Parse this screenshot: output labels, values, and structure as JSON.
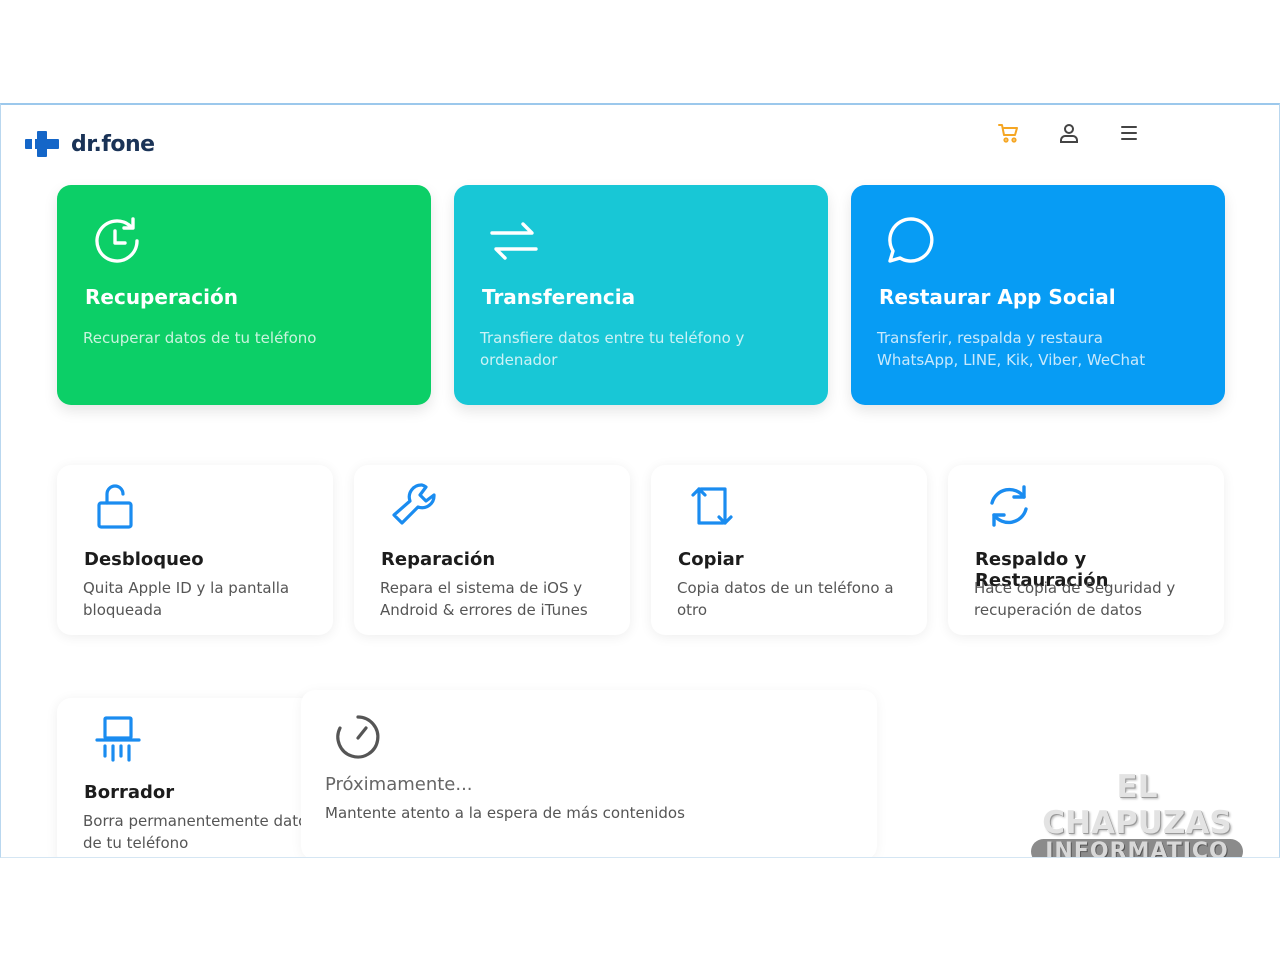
{
  "app": {
    "logo_text": "dr.fone"
  },
  "header": {
    "icons": [
      {
        "name": "cart-icon",
        "color": "#f5a623"
      },
      {
        "name": "user-icon",
        "color": "#444444"
      },
      {
        "name": "menu-icon",
        "color": "#444444"
      }
    ]
  },
  "featured": [
    {
      "id": "recuperacion",
      "icon": "clock-refresh-icon",
      "title": "Recuperación",
      "description": "Recuperar datos de tu teléfono",
      "color": "#0ccf67"
    },
    {
      "id": "transferencia",
      "icon": "transfer-arrows-icon",
      "title": "Transferencia",
      "description": "Transfiere datos entre tu teléfono y ordenador",
      "color": "#18c7d6"
    },
    {
      "id": "restaurar-app-social",
      "icon": "chat-bubble-icon",
      "title": "Restaurar App Social",
      "description": "Transferir, respalda y restaura WhatsApp, LINE, Kik, Viber, WeChat",
      "color": "#079cf4"
    }
  ],
  "tools": [
    {
      "id": "desbloqueo",
      "icon": "unlock-icon",
      "title": "Desbloqueo",
      "description": "Quita Apple ID y la pantalla bloqueada"
    },
    {
      "id": "reparacion",
      "icon": "wrench-icon",
      "title": "Reparación",
      "description": "Repara el sistema de iOS y Android & errores de iTunes"
    },
    {
      "id": "copiar",
      "icon": "phone-rotate-icon",
      "title": "Copiar",
      "description": "Copia datos de un teléfono a otro"
    },
    {
      "id": "respaldo",
      "icon": "sync-icon",
      "title": "Respaldo y Restauración",
      "description": "Hace copia de Seguridad y recuperación de datos"
    },
    {
      "id": "borrador",
      "icon": "shredder-icon",
      "title": "Borrador",
      "description": "Borra permanentemente datos de tu teléfono"
    }
  ],
  "coming_soon": {
    "icon": "timer-icon",
    "title": "Próximamente...",
    "description": "Mantente atento a la espera de más contenidos"
  },
  "watermark": {
    "line1": "EL CHAPUZAS",
    "line2": "INFORMATICO"
  },
  "colors": {
    "accent": "#1a8cf0",
    "icon_blue": "#1a8cf0"
  }
}
